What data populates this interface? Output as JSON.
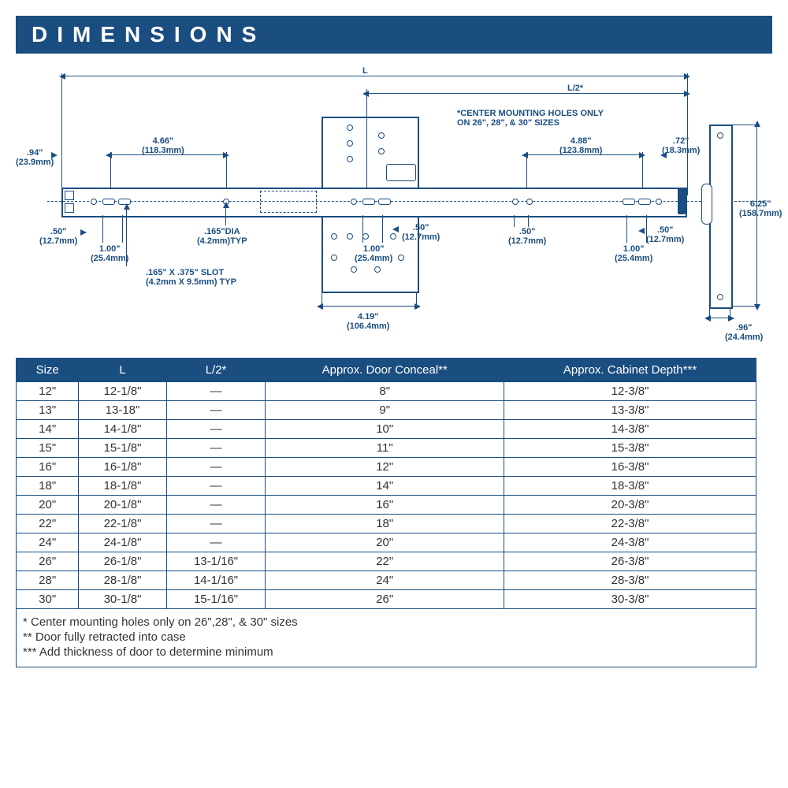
{
  "title": "DIMENSIONS",
  "diagram": {
    "L": "L",
    "Lhalf": "L/2*",
    "d94": ".94\"\n(23.9mm)",
    "d466": "4.66\"\n(118.3mm)",
    "note_center": "*CENTER MOUNTING HOLES ONLY\nON 26\", 28\", & 30\" SIZES",
    "d488": "4.88\"\n(123.8mm)",
    "d72": ".72\"\n(18.3mm)",
    "d625": "6.25\"\n(158.7mm)",
    "d50a": ".50\"\n(12.7mm)",
    "d100a": "1.00\"\n(25.4mm)",
    "d165dia": ".165\"DIA\n(4.2mm)TYP",
    "d165slot": ".165\" X .375\" SLOT\n(4.2mm X 9.5mm) TYP",
    "d100b": "1.00\"\n(25.4mm)",
    "d50b": ".50\"\n(12.7mm)",
    "d50c": ".50\"\n(12.7mm)",
    "d50d": ".50\"\n(12.7mm)",
    "d100c": "1.00\"\n(25.4mm)",
    "d419": "4.19\"\n(106.4mm)",
    "d96": ".96\"\n(24.4mm)"
  },
  "table": {
    "headers": [
      "Size",
      "L",
      "L/2*",
      "Approx. Door Conceal**",
      "Approx. Cabinet Depth***"
    ],
    "rows": [
      [
        "12\"",
        "12-1/8\"",
        "—",
        "8\"",
        "12-3/8\""
      ],
      [
        "13\"",
        "13-18\"",
        "—",
        "9\"",
        "13-3/8\""
      ],
      [
        "14\"",
        "14-1/8\"",
        "—",
        "10\"",
        "14-3/8\""
      ],
      [
        "15\"",
        "15-1/8\"",
        "—",
        "11\"",
        "15-3/8\""
      ],
      [
        "16\"",
        "16-1/8\"",
        "—",
        "12\"",
        "16-3/8\""
      ],
      [
        "18\"",
        "18-1/8\"",
        "—",
        "14\"",
        "18-3/8\""
      ],
      [
        "20\"",
        "20-1/8\"",
        "—",
        "16\"",
        "20-3/8\""
      ],
      [
        "22\"",
        "22-1/8\"",
        "—",
        "18\"",
        "22-3/8\""
      ],
      [
        "24\"",
        "24-1/8\"",
        "—",
        "20\"",
        "24-3/8\""
      ],
      [
        "26\"",
        "26-1/8\"",
        "13-1/16\"",
        "22\"",
        "26-3/8\""
      ],
      [
        "28\"",
        "28-1/8\"",
        "14-1/16\"",
        "24\"",
        "28-3/8\""
      ],
      [
        "30\"",
        "30-1/8\"",
        "15-1/16\"",
        "26\"",
        "30-3/8\""
      ]
    ]
  },
  "footnotes": {
    "f1": "*     Center mounting holes only on 26\",28\", & 30\" sizes",
    "f2": "**   Door fully retracted into case",
    "f3": "*** Add thickness of door to determine minimum"
  }
}
